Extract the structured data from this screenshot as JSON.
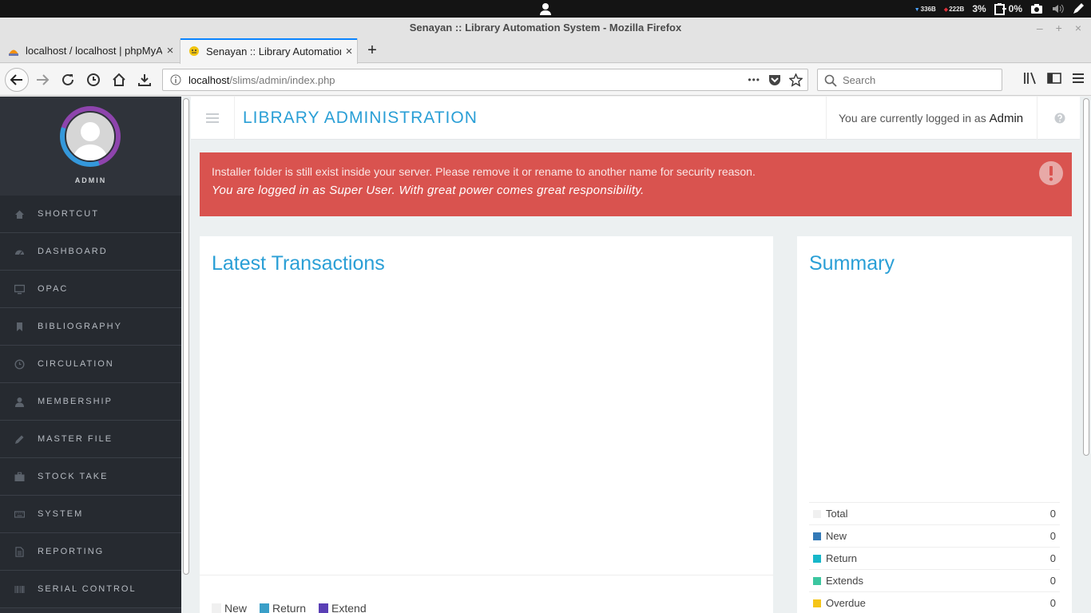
{
  "os": {
    "net_down": "336B",
    "net_up": "222B",
    "cpu": "3%",
    "battery": "0%"
  },
  "window": {
    "title": "Senayan :: Library Automation System - Mozilla Firefox",
    "minimize": "–",
    "maximize": "+",
    "close": "×"
  },
  "tabs": [
    {
      "label": "localhost / localhost | phpMyA",
      "close": "×"
    },
    {
      "label": "Senayan :: Library Automation",
      "close": "×"
    }
  ],
  "new_tab": "+",
  "address": {
    "host": "localhost",
    "path": "/slims/admin/index.php",
    "more": "•••"
  },
  "search": {
    "placeholder": "Search"
  },
  "sidebar": {
    "user": "ADMIN",
    "items": [
      {
        "label": "SHORTCUT",
        "icon": "home-icon"
      },
      {
        "label": "DASHBOARD",
        "icon": "dashboard-icon"
      },
      {
        "label": "OPAC",
        "icon": "monitor-icon"
      },
      {
        "label": "BIBLIOGRAPHY",
        "icon": "bookmark-icon"
      },
      {
        "label": "CIRCULATION",
        "icon": "clock-icon"
      },
      {
        "label": "MEMBERSHIP",
        "icon": "user-icon"
      },
      {
        "label": "MASTER FILE",
        "icon": "pencil-icon"
      },
      {
        "label": "STOCK TAKE",
        "icon": "briefcase-icon"
      },
      {
        "label": "SYSTEM",
        "icon": "keyboard-icon"
      },
      {
        "label": "REPORTING",
        "icon": "file-icon"
      },
      {
        "label": "SERIAL CONTROL",
        "icon": "barcode-icon"
      }
    ]
  },
  "header": {
    "title": "LIBRARY ADMINISTRATION",
    "login_prefix": "You are currently logged in as",
    "login_user": "Admin"
  },
  "alert": {
    "line1": "Installer folder is still exist inside your server. Please remove it or rename to another name for security reason.",
    "line2": "You are logged in as Super User. With great power comes great responsibility."
  },
  "transactions": {
    "title": "Latest Transactions",
    "legend": [
      {
        "label": "New",
        "color": "#f0f0f0"
      },
      {
        "label": "Return",
        "color": "#3a9fc8"
      },
      {
        "label": "Extend",
        "color": "#5a3fb5"
      }
    ]
  },
  "summary": {
    "title": "Summary",
    "rows": [
      {
        "label": "Total",
        "value": "0",
        "color": "#f0f0f0"
      },
      {
        "label": "New",
        "value": "0",
        "color": "#337ab7"
      },
      {
        "label": "Return",
        "value": "0",
        "color": "#17b7c9"
      },
      {
        "label": "Extends",
        "value": "0",
        "color": "#3cc6a0"
      },
      {
        "label": "Overdue",
        "value": "0",
        "color": "#f5c518"
      }
    ]
  },
  "colors": {
    "accent": "#2a9fd6",
    "alert": "#d9534f",
    "sidebar": "#2b2f36"
  }
}
